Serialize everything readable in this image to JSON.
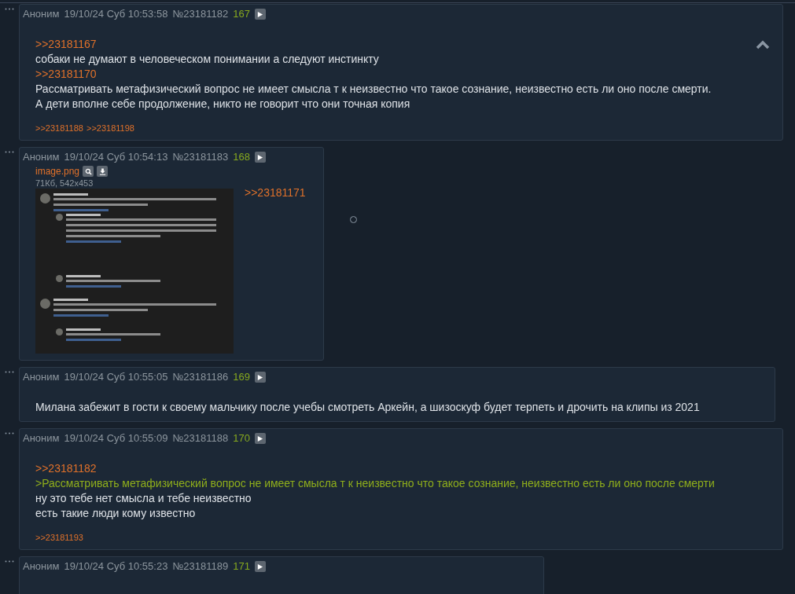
{
  "posts": [
    {
      "name": "Аноним",
      "date": "19/10/24 Суб 10:53:58",
      "number": "№23181182",
      "index": "167",
      "lines": [
        {
          "kind": "link",
          "text": ">>23181167"
        },
        {
          "kind": "text",
          "text": "собаки не думают в человеческом понимании а следуют инстинкту"
        },
        {
          "kind": "link",
          "text": ">>23181170"
        },
        {
          "kind": "text",
          "text": "Рассматривать метафизический вопрос не имеет смысла т к неизвестно что такое сознание, неизвестно есть ли оно после смерти."
        },
        {
          "kind": "text",
          "text": "А дети вполне себе продолжение, никто не говорит что они точная копия"
        }
      ],
      "replies": [
        ">>23181188",
        ">>23181198"
      ]
    },
    {
      "name": "Аноним",
      "date": "19/10/24 Суб 10:54:13",
      "number": "№23181183",
      "index": "168",
      "image": {
        "filename": "image.png",
        "size": "71Кб, 542x453",
        "kind": "picture"
      },
      "lines": [
        {
          "kind": "link",
          "text": ">>23181171"
        }
      ]
    },
    {
      "name": "Аноним",
      "date": "19/10/24 Суб 10:55:05",
      "number": "№23181186",
      "index": "169",
      "lines": [
        {
          "kind": "text",
          "text": "Милана забежит в гости к своему мальчику после учебы смотреть Аркейн, а шизоскуф будет терпеть и дрочить на клипы из 2021"
        }
      ]
    },
    {
      "name": "Аноним",
      "date": "19/10/24 Суб 10:55:09",
      "number": "№23181188",
      "index": "170",
      "lines": [
        {
          "kind": "link",
          "text": ">>23181182"
        },
        {
          "kind": "quote",
          "text": ">Рассматривать метафизический вопрос не имеет смысла т к неизвестно что такое сознание, неизвестно есть ли оно после смерти"
        },
        {
          "kind": "text",
          "text": "ну это тебе нет смысла и тебе неизвестно"
        },
        {
          "kind": "text",
          "text": "есть такие люди кому известно"
        }
      ],
      "replies": [
        ">>23181193"
      ]
    },
    {
      "name": "Аноним",
      "date": "19/10/24 Суб 10:55:23",
      "number": "№23181189",
      "index": "171"
    }
  ]
}
